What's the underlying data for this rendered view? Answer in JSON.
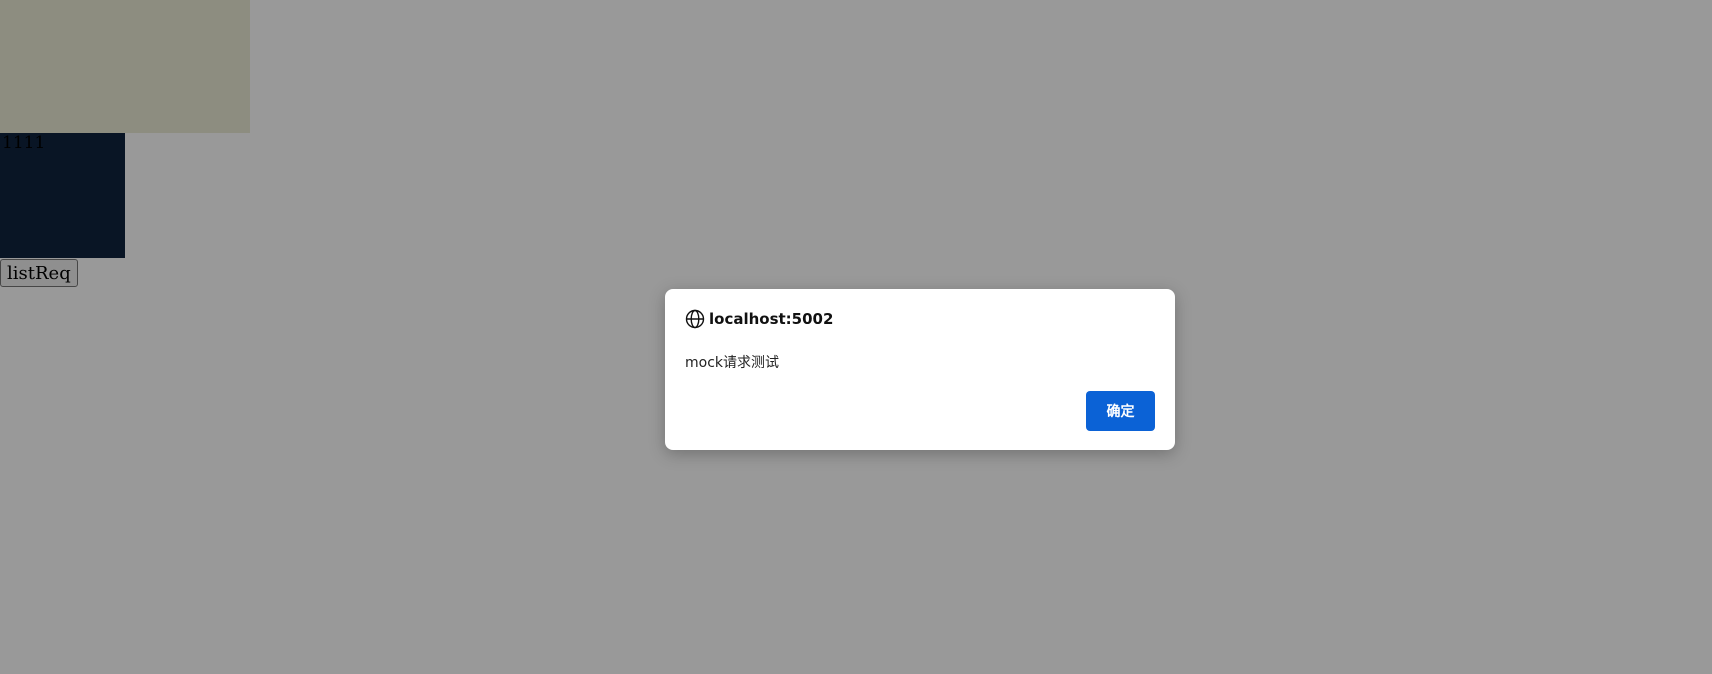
{
  "page": {
    "odd_text": "1111",
    "list_button_label": "listReq"
  },
  "dialog": {
    "origin": "localhost:5002",
    "message": "mock请求测试",
    "ok_label": "确定",
    "icon": "globe-icon"
  },
  "colors": {
    "yellow_box": "#ebebd6",
    "navy_box": "#10243e",
    "overlay": "rgba(0,0,0,0.4)",
    "ok_button": "#0b62d6"
  }
}
